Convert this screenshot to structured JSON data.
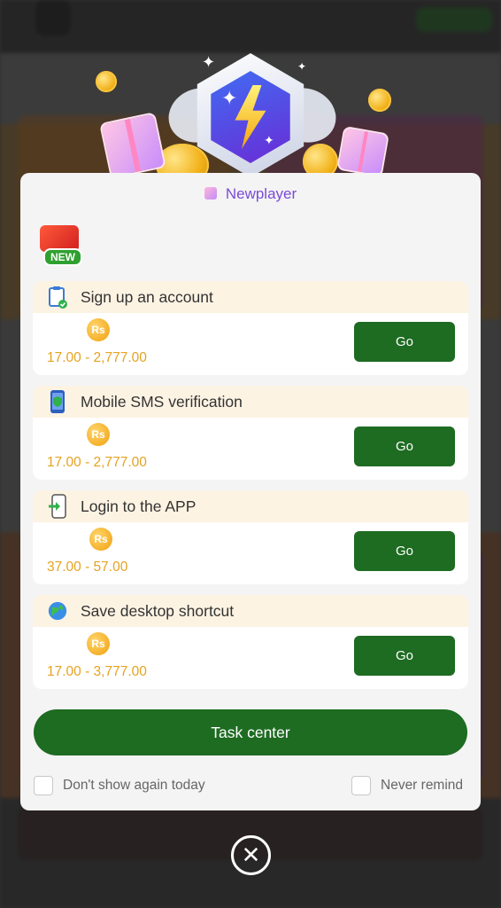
{
  "dialog": {
    "title": "Newplayer",
    "new_badge_label": "NEW",
    "tasks": [
      {
        "title": "Sign up an account",
        "icon": "clipboard-check-icon",
        "coin_label": "Rs",
        "reward": "17.00 - 2,777.00",
        "action_label": "Go"
      },
      {
        "title": "Mobile SMS verification",
        "icon": "phone-shield-icon",
        "coin_label": "Rs",
        "reward": "17.00 - 2,777.00",
        "action_label": "Go"
      },
      {
        "title": "Login to the APP",
        "icon": "phone-login-icon",
        "coin_label": "Rs",
        "reward": "37.00 - 57.00",
        "action_label": "Go"
      },
      {
        "title": "Save desktop shortcut",
        "icon": "globe-icon",
        "coin_label": "Rs",
        "reward": "17.00 - 3,777.00",
        "action_label": "Go"
      }
    ],
    "task_center_label": "Task center",
    "dont_show_today_label": "Don't show again today",
    "never_remind_label": "Never remind"
  },
  "colors": {
    "primary_green": "#1e6b22",
    "reward_gold": "#e5a321",
    "title_purple": "#7b4bd6",
    "header_cream": "#fdf3e3"
  }
}
